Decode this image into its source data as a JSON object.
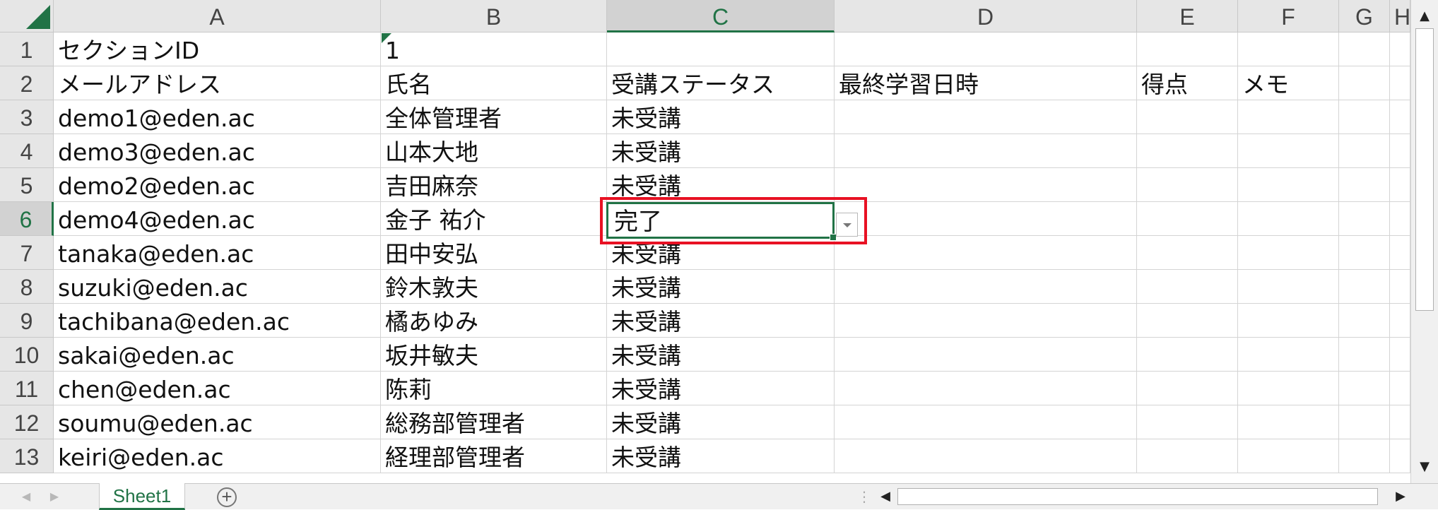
{
  "columns": [
    "A",
    "B",
    "C",
    "D",
    "E",
    "F",
    "G",
    "H"
  ],
  "rows": [
    {
      "num": "1",
      "a": "セクションID",
      "b": "1",
      "c": "",
      "d": "",
      "e": "",
      "f": ""
    },
    {
      "num": "2",
      "a": "メールアドレス",
      "b": "氏名",
      "c": "受講ステータス",
      "d": "最終学習日時",
      "e": "得点",
      "f": "メモ"
    },
    {
      "num": "3",
      "a": "demo1@eden.ac",
      "b": "全体管理者",
      "c": "未受講",
      "d": "",
      "e": "",
      "f": ""
    },
    {
      "num": "4",
      "a": "demo3@eden.ac",
      "b": "山本大地",
      "c": "未受講",
      "d": "",
      "e": "",
      "f": ""
    },
    {
      "num": "5",
      "a": "demo2@eden.ac",
      "b": "吉田麻奈",
      "c": "未受講",
      "d": "",
      "e": "",
      "f": ""
    },
    {
      "num": "6",
      "a": "demo4@eden.ac",
      "b": "金子 祐介",
      "c": "完了",
      "d": "",
      "e": "",
      "f": ""
    },
    {
      "num": "7",
      "a": "tanaka@eden.ac",
      "b": "田中安弘",
      "c": "未受講",
      "d": "",
      "e": "",
      "f": ""
    },
    {
      "num": "8",
      "a": "suzuki@eden.ac",
      "b": "鈴木敦夫",
      "c": "未受講",
      "d": "",
      "e": "",
      "f": ""
    },
    {
      "num": "9",
      "a": "tachibana@eden.ac",
      "b": "橘あゆみ",
      "c": "未受講",
      "d": "",
      "e": "",
      "f": ""
    },
    {
      "num": "10",
      "a": "sakai@eden.ac",
      "b": "坂井敏夫",
      "c": "未受講",
      "d": "",
      "e": "",
      "f": ""
    },
    {
      "num": "11",
      "a": "chen@eden.ac",
      "b": "陈莉",
      "c": "未受講",
      "d": "",
      "e": "",
      "f": ""
    },
    {
      "num": "12",
      "a": "soumu@eden.ac",
      "b": "総務部管理者",
      "c": "未受講",
      "d": "",
      "e": "",
      "f": ""
    },
    {
      "num": "13",
      "a": "keiri@eden.ac",
      "b": "経理部管理者",
      "c": "未受講",
      "d": "",
      "e": "",
      "f": ""
    }
  ],
  "active_cell": {
    "column": "C",
    "row": "6",
    "value": "完了"
  },
  "sheet_tab": "Sheet1",
  "add_sheet_symbol": "+",
  "colors": {
    "accent": "#217346",
    "highlight_box": "#e81123",
    "header_bg": "#e6e6e6"
  }
}
